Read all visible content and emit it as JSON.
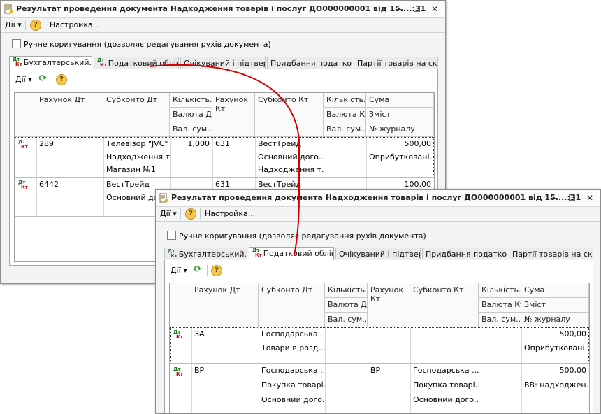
{
  "window1": {
    "title": "Результат проведення документа Надходження товарів і послуг ДО000000001 від 15....:31",
    "toolbar": {
      "actions": "Дії",
      "settings": "Настройка..."
    },
    "manual_edit": "Ручне коригування (дозволяє редагування рухів документа)",
    "tabs": [
      "Бухгалтерський...",
      "Податковий облік",
      "Очікуваний і підтвер...",
      "Придбання податко...",
      "Партії товарів на ск..."
    ],
    "grid_actions": "Дії",
    "headers": {
      "dt_account": "Рахунок Дт",
      "dt_subconto": "Субконто Дт",
      "dt_qty": "Кількість...",
      "dt_currency": "Валюта Дт",
      "dt_cur_amount": "Вал. сум...",
      "kt_account": "Рахунок Кт",
      "kt_subconto": "Субконто Кт",
      "kt_qty": "Кількість...",
      "kt_currency": "Валюта Кт",
      "kt_cur_amount": "Вал. сум...",
      "amount": "Сума",
      "content": "Зміст",
      "journal": "№ журналу"
    },
    "rows": [
      {
        "dt_account": "289",
        "dt_sub": [
          "Телевізор \"JVC\"",
          "Надходження т...",
          "Магазин №1"
        ],
        "dt_qty": "1,000",
        "kt_account": "631",
        "kt_sub": [
          "ВестТрейд",
          "Основний дого...",
          "Надходження т..."
        ],
        "amount": "500,00",
        "content": "Оприбутковані..."
      },
      {
        "dt_account": "6442",
        "dt_sub": [
          "ВестТрейд",
          "Основний дого..."
        ],
        "dt_qty": "",
        "kt_account": "631",
        "kt_sub": [
          "ВестТрейд",
          ""
        ],
        "amount": "100,00",
        "content": ""
      }
    ]
  },
  "window2": {
    "title": "Результат проведення документа Надходження товарів і послуг ДО000000001 від 15....:31",
    "toolbar": {
      "actions": "Дії",
      "settings": "Настройка..."
    },
    "manual_edit": "Ручне коригування (дозволяє редагування рухів документа)",
    "tabs": [
      "Бухгалтерський...",
      "Податковий облік",
      "Очікуваний і підтвер...",
      "Придбання податко...",
      "Партії товарів на ск..."
    ],
    "grid_actions": "Дії",
    "headers": {
      "dt_account": "Рахунок Дт",
      "dt_subconto": "Субконто Дт",
      "dt_qty": "Кількість...",
      "dt_currency": "Валюта Дт",
      "dt_cur_amount": "Вал. сум...",
      "kt_account": "Рахунок Кт",
      "kt_subconto": "Субконто Кт",
      "kt_qty": "Кількість...",
      "kt_currency": "Валюта Кт",
      "kt_cur_amount": "Вал. сум...",
      "amount": "Сума",
      "content": "Зміст",
      "journal": "№ журналу"
    },
    "rows": [
      {
        "dt_account": "ЗА",
        "dt_sub": [
          "Господарська ...",
          "Товари в розд..."
        ],
        "kt_account": "",
        "kt_sub": [
          "",
          ""
        ],
        "amount": "500,00",
        "content": "Оприбутковані..."
      },
      {
        "dt_account": "ВР",
        "dt_sub": [
          "Господарська ...",
          "Покупка товарі...",
          "Основний дого..."
        ],
        "kt_account": "ВР",
        "kt_sub": [
          "Господарська ...",
          "Покупка товарі...",
          "Основний дого..."
        ],
        "amount": "500,00",
        "content": "ВВ: надходжен..."
      }
    ]
  },
  "icons": {
    "window": "document-icon",
    "help": "help-icon",
    "refresh": "refresh-icon",
    "minimize": "minimize-icon",
    "maximize": "maximize-icon",
    "close": "close-icon",
    "dt_kt": "dt-kt-icon"
  },
  "colors": {
    "dt": "#1b7a1b",
    "kt": "#b41414",
    "connector": "#d40000",
    "help": "#f5c74a",
    "refresh": "#2c9a2c"
  }
}
